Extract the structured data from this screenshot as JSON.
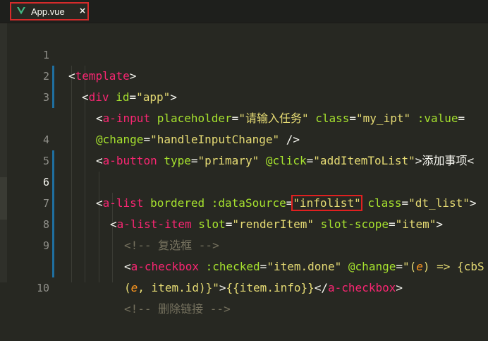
{
  "tab": {
    "filename": "App.vue",
    "close_glyph": "×",
    "icon": "vue-icon"
  },
  "colors": {
    "tag": "#f92672",
    "attr": "#a6e22e",
    "string": "#e6db74",
    "comment": "#75715e",
    "highlight_box": "#e02020",
    "tab_border": "#d62b2b"
  },
  "lines": [
    {
      "num": "1"
    },
    {
      "num": "2"
    },
    {
      "num": "3"
    },
    {
      "num": ""
    },
    {
      "num": "4"
    },
    {
      "num": "5"
    },
    {
      "num": "6"
    },
    {
      "num": "7"
    },
    {
      "num": "8"
    },
    {
      "num": "9"
    },
    {
      "num": ""
    },
    {
      "num": "10"
    }
  ],
  "code": {
    "l1": {
      "open": "<",
      "tag": "template",
      "close": ">"
    },
    "l2": {
      "open": "<",
      "tag": "div",
      "attr": " id",
      "eq": "=",
      "val": "\"app\"",
      "close": ">"
    },
    "l3": {
      "open": "<",
      "tag": "a-input",
      "a1": " placeholder",
      "eq1": "=",
      "v1": "\"请输入任务\"",
      "a2": " class",
      "eq2": "=",
      "v2": "\"my_ipt\"",
      "a3": " :value",
      "eq3": "="
    },
    "l3b": {
      "a1": "@change",
      "eq1": "=",
      "v1": "\"handleInputChange\"",
      "close": " />"
    },
    "l4": {
      "open": "<",
      "tag": "a-button",
      "a1": " type",
      "eq1": "=",
      "v1": "\"primary\"",
      "a2": " @click",
      "eq2": "=",
      "v2": "\"addItemToList\"",
      "close": ">",
      "text": "添加事项",
      "end": "<"
    },
    "l6": {
      "open": "<",
      "tag": "a-list",
      "a1": " bordered",
      "a2": " :dataSource",
      "eq2": "=",
      "v2": "\"infolist\"",
      "a3": " class",
      "eq3": "=",
      "v3": "\"dt_list\"",
      "close": ">"
    },
    "l7": {
      "open": "<",
      "tag": "a-list-item",
      "a1": " slot",
      "eq1": "=",
      "v1": "\"renderItem\"",
      "a2": " slot-scope",
      "eq2": "=",
      "v2": "\"item\"",
      "close": ">"
    },
    "l8": {
      "comment": "<!-- 复选框 -->"
    },
    "l9": {
      "open": "<",
      "tag": "a-checkbox",
      "a1": " :checked",
      "eq1": "=",
      "v1": "\"item.done\"",
      "a2": " @change",
      "eq2": "=",
      "q1": "\"(",
      "p1": "e",
      "q2": ") => {cbS"
    },
    "l9b": {
      "q1": "(",
      "p1": "e",
      "q2": ", item.id)}\"",
      "close": ">",
      "text": "{{item.info}}",
      "end": "</",
      "tag": "a-checkbox",
      "close2": ">"
    },
    "l10": {
      "comment": "<!-- 删除链接 -->"
    }
  }
}
